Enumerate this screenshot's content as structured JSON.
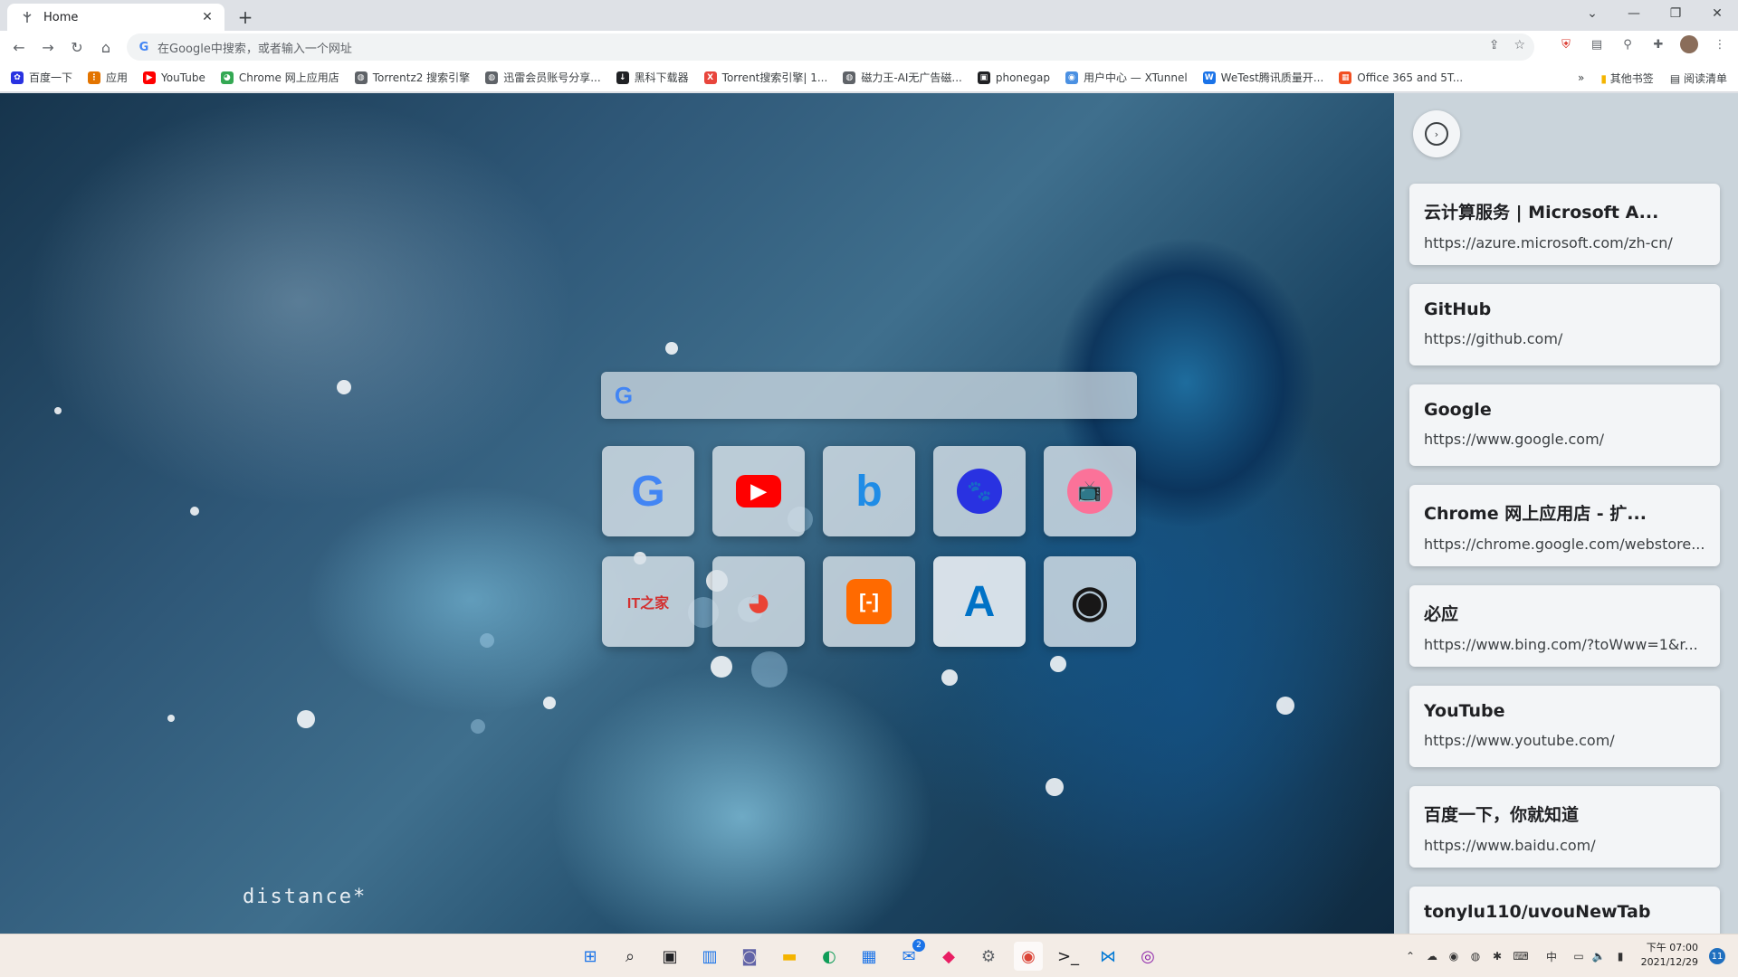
{
  "browser": {
    "tab": {
      "title": "Home"
    },
    "omnibox": {
      "placeholder": "在Google中搜索，或者输入一个网址"
    }
  },
  "bookmarks": [
    {
      "label": "百度一下",
      "icon": "baidu-icon",
      "color": "#2932e1",
      "glyph": "✿"
    },
    {
      "label": "应用",
      "icon": "apps-grid-icon",
      "color": "#e37400",
      "glyph": "⋮"
    },
    {
      "label": "YouTube",
      "icon": "youtube-icon",
      "color": "#ff0000",
      "glyph": "▶"
    },
    {
      "label": "Chrome 网上应用店",
      "icon": "chrome-webstore-icon",
      "color": "#34a853",
      "glyph": "◕"
    },
    {
      "label": "Torrentz2 搜索引擎",
      "icon": "globe-icon",
      "color": "#5f6368",
      "glyph": "◍"
    },
    {
      "label": "迅雷会员账号分享...",
      "icon": "globe-icon",
      "color": "#5f6368",
      "glyph": "◍"
    },
    {
      "label": "黑科下载器",
      "icon": "download-icon",
      "color": "#202124",
      "glyph": "↓"
    },
    {
      "label": "Torrent搜索引擎| 1...",
      "icon": "x-icon",
      "color": "#e8453c",
      "glyph": "X"
    },
    {
      "label": "磁力王-AI无广告磁...",
      "icon": "globe-icon",
      "color": "#5f6368",
      "glyph": "◍"
    },
    {
      "label": "phonegap",
      "icon": "phonegap-icon",
      "color": "#202124",
      "glyph": "▣"
    },
    {
      "label": "用户中心 — XTunnel",
      "icon": "xtunnel-icon",
      "color": "#4a90e2",
      "glyph": "◉"
    },
    {
      "label": "WeTest腾讯质量开...",
      "icon": "wetest-icon",
      "color": "#1a73e8",
      "glyph": "W"
    },
    {
      "label": "Office 365 and 5T...",
      "icon": "microsoft-icon",
      "color": "#f25022",
      "glyph": "▦"
    }
  ],
  "bookmarks_right": {
    "more": "»",
    "other": "其他书签",
    "reading": "阅读清单"
  },
  "search": {
    "placeholder": ""
  },
  "tiles": [
    {
      "name": "google",
      "glyph": "G",
      "color": "#4285f4",
      "bg": "rgba(215,225,232,0.82)"
    },
    {
      "name": "youtube",
      "glyph": "▶",
      "color": "#ffffff",
      "bg": "rgba(215,225,232,0.82)"
    },
    {
      "name": "bing",
      "glyph": "b",
      "color": "#1f8ce6",
      "bg": "rgba(215,225,232,0.82)"
    },
    {
      "name": "baidu",
      "glyph": "🐾",
      "color": "#ffffff",
      "bg": "rgba(215,225,232,0.82)"
    },
    {
      "name": "bilibili",
      "glyph": "📺",
      "color": "#fb7299",
      "bg": "rgba(215,225,232,0.82)"
    },
    {
      "name": "ithome",
      "glyph": "IT之家",
      "color": "#d32f2f",
      "bg": "rgba(215,225,232,0.82)"
    },
    {
      "name": "chrome-webstore",
      "glyph": "◕",
      "color": "#ea4335",
      "bg": "rgba(215,225,232,0.82)"
    },
    {
      "name": "aliyun",
      "glyph": "[-]",
      "color": "#ffffff",
      "bg": "rgba(215,225,232,0.82)"
    },
    {
      "name": "azure",
      "glyph": "A",
      "color": "#0072c6",
      "bg": "rgba(235,240,244,0.9)"
    },
    {
      "name": "github",
      "glyph": "◉",
      "color": "#181717",
      "bg": "rgba(215,225,232,0.82)"
    }
  ],
  "wallpaper": {
    "signature": "distance*"
  },
  "history": [
    {
      "title": "云计算服务 | Microsoft A...",
      "url": "https://azure.microsoft.com/zh-cn/"
    },
    {
      "title": "GitHub",
      "url": "https://github.com/"
    },
    {
      "title": "Google",
      "url": "https://www.google.com/"
    },
    {
      "title": "Chrome 网上应用店 - 扩...",
      "url": "https://chrome.google.com/webstore..."
    },
    {
      "title": "必应",
      "url": "https://www.bing.com/?toWww=1&r..."
    },
    {
      "title": "YouTube",
      "url": "https://www.youtube.com/"
    },
    {
      "title": "百度一下，你就知道",
      "url": "https://www.baidu.com/"
    },
    {
      "title": "tonylu110/uvouNewTab",
      "url": ""
    }
  ],
  "taskbar": {
    "apps": [
      {
        "name": "start-icon",
        "glyph": "⊞",
        "color": "#1a73e8"
      },
      {
        "name": "search-icon",
        "glyph": "⌕",
        "color": "#202124"
      },
      {
        "name": "task-view-icon",
        "glyph": "▣",
        "color": "#202124"
      },
      {
        "name": "widgets-icon",
        "glyph": "▥",
        "color": "#1a73e8"
      },
      {
        "name": "teams-chat-icon",
        "glyph": "◙",
        "color": "#6264a7"
      },
      {
        "name": "file-explorer-icon",
        "glyph": "▬",
        "color": "#f4b400"
      },
      {
        "name": "edge-icon",
        "glyph": "◐",
        "color": "#0f9d58"
      },
      {
        "name": "store-icon",
        "glyph": "▦",
        "color": "#1a73e8"
      },
      {
        "name": "mail-icon",
        "glyph": "✉",
        "color": "#1a73e8"
      },
      {
        "name": "photos-icon",
        "glyph": "◆",
        "color": "#e91e63"
      },
      {
        "name": "settings-icon",
        "glyph": "⚙",
        "color": "#5f6368"
      },
      {
        "name": "chrome-icon",
        "glyph": "◉",
        "color": "#db4437"
      },
      {
        "name": "terminal-icon",
        "glyph": ">_",
        "color": "#202124"
      },
      {
        "name": "vscode-icon",
        "glyph": "⋈",
        "color": "#0078d4"
      },
      {
        "name": "podcast-icon",
        "glyph": "◎",
        "color": "#8e24aa"
      }
    ],
    "mail_badge": "2",
    "ime": "中",
    "time_period": "下午 07:00",
    "date": "2021/12/29",
    "notifications": "11"
  }
}
